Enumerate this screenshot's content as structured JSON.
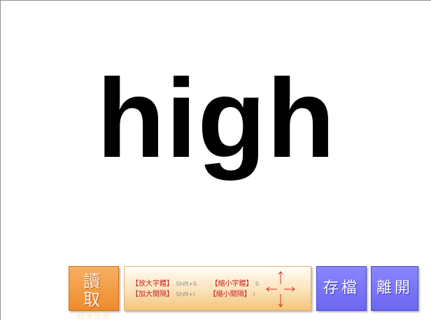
{
  "display": {
    "word": "high"
  },
  "toolbar": {
    "read_button": {
      "label": "讀 取",
      "sublabel": "標準座標"
    },
    "help": {
      "enlarge_font": "【放大字體】",
      "enlarge_font_key": "Shift+S",
      "shrink_font": "【縮小字體】",
      "shrink_font_key": "S",
      "increase_spacing": "【加大間隔】",
      "increase_spacing_key": "Shift+I",
      "decrease_spacing": "【縮小間隔】",
      "decrease_spacing_key": "I",
      "arrow_icon": "four-direction-arrows-icon"
    },
    "save_label": "存檔",
    "exit_label": "離開"
  },
  "colors": {
    "read_button": "#f08a2c",
    "action_button": "#6c66f2",
    "help_text": "#c62020",
    "arrow": "#d03020"
  }
}
